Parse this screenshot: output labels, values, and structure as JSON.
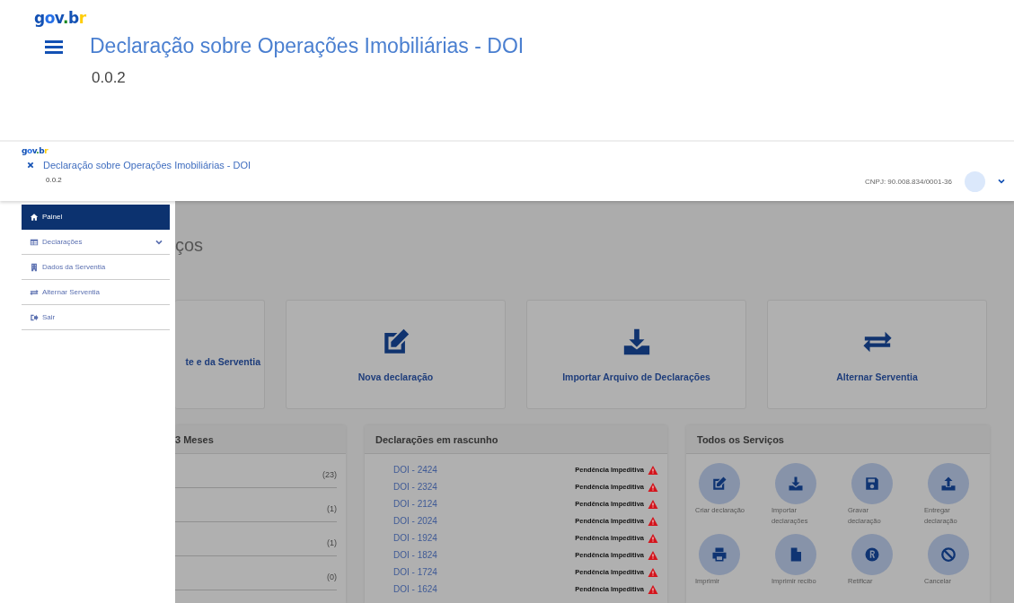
{
  "zoomed_header": {
    "logo": "gov.br",
    "title": "Declaração sobre Operações Imobiliárias - DOI",
    "version": "0.0.2"
  },
  "header": {
    "logo": "gov.br",
    "title": "Declaração sobre Operações Imobiliárias - DOI",
    "version": "0.0.2",
    "cnpj": "CNPJ: 90.008.834/0001-36"
  },
  "sidebar": {
    "items": [
      {
        "label": "Painel",
        "kind": "home",
        "selected": true
      },
      {
        "label": "Declarações",
        "kind": "table",
        "selected": false,
        "expanded": false
      },
      {
        "label": "Dados da Serventia",
        "kind": "building",
        "selected": false
      },
      {
        "label": "Alternar Serventia",
        "kind": "swap",
        "selected": false
      },
      {
        "label": "Sair",
        "kind": "exit",
        "selected": false
      }
    ]
  },
  "page_heading": "ços",
  "cards": [
    {
      "label": "te e da Serventia",
      "kind": "none"
    },
    {
      "label": "Nova declaração",
      "kind": "edit"
    },
    {
      "label": "Importar Arquivo de Declarações",
      "kind": "download"
    },
    {
      "label": "Alternar Serventia",
      "kind": "swap"
    }
  ],
  "months_panel": {
    "title": "3 Meses",
    "rows": [
      {
        "count": "(23)"
      },
      {
        "count": "(1)"
      },
      {
        "count": "(1)"
      },
      {
        "count": "(0)"
      }
    ]
  },
  "drafts_panel": {
    "title": "Declarações em rascunho",
    "items": [
      {
        "label": "DOI - 2424",
        "status": "Pendência Impeditiva"
      },
      {
        "label": "DOI - 2324",
        "status": "Pendência Impeditiva"
      },
      {
        "label": "DOI - 2124",
        "status": "Pendência Impeditiva"
      },
      {
        "label": "DOI - 2024",
        "status": "Pendência Impeditiva"
      },
      {
        "label": "DOI - 1924",
        "status": "Pendência Impeditiva"
      },
      {
        "label": "DOI - 1824",
        "status": "Pendência Impeditiva"
      },
      {
        "label": "DOI - 1724",
        "status": "Pendência Impeditiva"
      },
      {
        "label": "DOI - 1624",
        "status": "Pendência Impeditiva"
      }
    ]
  },
  "services_panel": {
    "title": "Todos os Serviços",
    "items": [
      {
        "label": "Criar declaração",
        "kind": "edit"
      },
      {
        "label": "Importar declarações",
        "kind": "download"
      },
      {
        "label": "Gravar declaração",
        "kind": "save"
      },
      {
        "label": "Entregar declaração",
        "kind": "upload"
      },
      {
        "label": "Imprimir",
        "kind": "print"
      },
      {
        "label": "Imprimir recibo",
        "kind": "file"
      },
      {
        "label": "Retificar",
        "kind": "rectify"
      },
      {
        "label": "Cancelar",
        "kind": "cancel"
      }
    ]
  }
}
